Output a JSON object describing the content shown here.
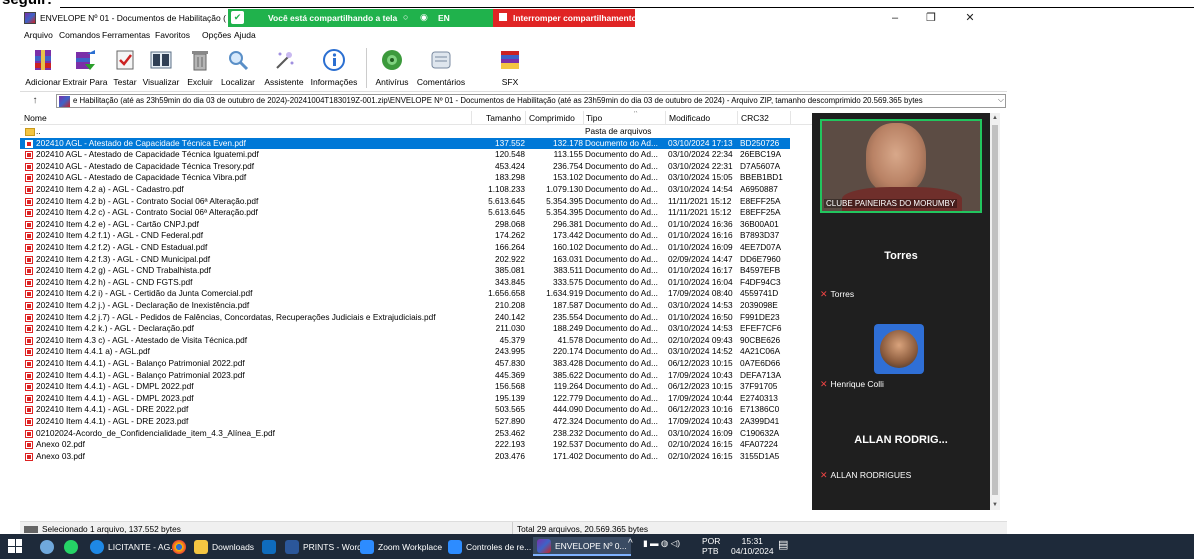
{
  "top_crop_text": "seguir:",
  "window": {
    "title": "ENVELOPE Nº 01 - Documentos de Habilitação (",
    "controls": {
      "minimize": "–",
      "maximize": "❐",
      "close": "✕"
    }
  },
  "share_bar": {
    "message": "Você está compartilhando a tela",
    "lang": "EN",
    "stop_label": "Interromper compartilhamento"
  },
  "menu": [
    "Arquivo",
    "Comandos",
    "Ferramentas",
    "Favoritos",
    "Opções",
    "Ajuda"
  ],
  "toolbar": [
    {
      "label": "Adicionar",
      "icon": "add-archive-icon",
      "color": "#b8322b"
    },
    {
      "label": "Extrair Para",
      "icon": "extract-icon",
      "color": "#6a3fb0"
    },
    {
      "label": "Testar",
      "icon": "test-icon",
      "color": "#c0392b"
    },
    {
      "label": "Visualizar",
      "icon": "view-icon",
      "color": "#6a8aa8"
    },
    {
      "label": "Excluir",
      "icon": "delete-icon",
      "color": "#8c8c8c"
    },
    {
      "label": "Localizar",
      "icon": "find-icon",
      "color": "#5a8fc7"
    },
    {
      "label": "Assistente",
      "icon": "wizard-icon",
      "color": "#8a6fc7"
    },
    {
      "label": "Informações",
      "icon": "info-icon",
      "color": "#2b6fd1"
    },
    {
      "label": "Antivírus",
      "icon": "antivirus-icon",
      "color": "#3c9a3c"
    },
    {
      "label": "Comentários",
      "icon": "comment-icon",
      "color": "#7a8aa0"
    },
    {
      "label": "SFX",
      "icon": "sfx-icon",
      "color": "#c0392b"
    }
  ],
  "address": {
    "up": "↑",
    "path": "e Habilitação (até as 23h59min do dia 03 de outubro de 2024)-20241004T183019Z-001.zip\\ENVELOPE Nº 01 - Documentos de Habilitação (até as 23h59min do dia 03 de outubro de 2024) - Arquivo ZIP, tamanho descomprimido 20.569.365 bytes"
  },
  "columns": {
    "name": "Nome",
    "size": "Tamanho",
    "compressed": "Comprimido",
    "type": "Tipo",
    "modified": "Modificado",
    "crc": "CRC32"
  },
  "files": [
    {
      "name": "..",
      "size": "",
      "compressed": "",
      "type": "Pasta de arquivos",
      "modified": "",
      "crc": "",
      "kind": "folder"
    },
    {
      "name": "202410 AGL - Atestado de Capacidade Técnica Even.pdf",
      "size": "137.552",
      "compressed": "132.178",
      "type": "Documento do Ad...",
      "modified": "03/10/2024 17:13",
      "crc": "BD250726",
      "kind": "pdf",
      "selected": true
    },
    {
      "name": "202410 AGL - Atestado de Capacidade Técnica Iguatemi.pdf",
      "size": "120.548",
      "compressed": "113.155",
      "type": "Documento do Ad...",
      "modified": "03/10/2024 22:34",
      "crc": "26EBC19A",
      "kind": "pdf"
    },
    {
      "name": "202410 AGL - Atestado de Capacidade Técnica Tresory.pdf",
      "size": "453.424",
      "compressed": "236.754",
      "type": "Documento do Ad...",
      "modified": "03/10/2024 22:31",
      "crc": "D7A5607A",
      "kind": "pdf"
    },
    {
      "name": "202410 AGL - Atestado de Capacidade Técnica Vibra.pdf",
      "size": "183.298",
      "compressed": "153.102",
      "type": "Documento do Ad...",
      "modified": "03/10/2024 15:05",
      "crc": "BBEB1BD1",
      "kind": "pdf"
    },
    {
      "name": "202410 Item 4.2 a) - AGL - Cadastro.pdf",
      "size": "1.108.233",
      "compressed": "1.079.130",
      "type": "Documento do Ad...",
      "modified": "03/10/2024 14:54",
      "crc": "A6950887",
      "kind": "pdf"
    },
    {
      "name": "202410 Item 4.2 b) - AGL - Contrato Social 06ª Alteração.pdf",
      "size": "5.613.645",
      "compressed": "5.354.395",
      "type": "Documento do Ad...",
      "modified": "11/11/2021 15:12",
      "crc": "E8EFF25A",
      "kind": "pdf"
    },
    {
      "name": "202410 Item 4.2 c) - AGL - Contrato Social 06ª Alteração.pdf",
      "size": "5.613.645",
      "compressed": "5.354.395",
      "type": "Documento do Ad...",
      "modified": "11/11/2021 15:12",
      "crc": "E8EFF25A",
      "kind": "pdf"
    },
    {
      "name": "202410 Item 4.2 e) - AGL - Cartão CNPJ.pdf",
      "size": "298.068",
      "compressed": "296.381",
      "type": "Documento do Ad...",
      "modified": "01/10/2024 16:36",
      "crc": "36B00A01",
      "kind": "pdf"
    },
    {
      "name": "202410 Item 4.2 f.1) - AGL - CND Federal.pdf",
      "size": "174.262",
      "compressed": "173.442",
      "type": "Documento do Ad...",
      "modified": "01/10/2024 16:16",
      "crc": "B7893D37",
      "kind": "pdf"
    },
    {
      "name": "202410 Item 4.2 f.2) - AGL - CND Estadual.pdf",
      "size": "166.264",
      "compressed": "160.102",
      "type": "Documento do Ad...",
      "modified": "01/10/2024 16:09",
      "crc": "4EE7D07A",
      "kind": "pdf"
    },
    {
      "name": "202410 Item 4.2 f.3) - AGL - CND Municipal.pdf",
      "size": "202.922",
      "compressed": "163.031",
      "type": "Documento do Ad...",
      "modified": "02/09/2024 14:47",
      "crc": "DD6E7960",
      "kind": "pdf"
    },
    {
      "name": "202410 Item 4.2 g) - AGL - CND Trabalhista.pdf",
      "size": "385.081",
      "compressed": "383.511",
      "type": "Documento do Ad...",
      "modified": "01/10/2024 16:17",
      "crc": "B4597EFB",
      "kind": "pdf"
    },
    {
      "name": "202410 Item 4.2 h) - AGL - CND FGTS.pdf",
      "size": "343.845",
      "compressed": "333.575",
      "type": "Documento do Ad...",
      "modified": "01/10/2024 16:04",
      "crc": "F4DF94C3",
      "kind": "pdf"
    },
    {
      "name": "202410 Item 4.2 i) - AGL - Certidão da Junta Comercial.pdf",
      "size": "1.656.658",
      "compressed": "1.634.919",
      "type": "Documento do Ad...",
      "modified": "17/09/2024 08:40",
      "crc": "4559741D",
      "kind": "pdf"
    },
    {
      "name": "202410 Item 4.2 j.) - AGL - Declaração de Inexistência.pdf",
      "size": "210.208",
      "compressed": "187.587",
      "type": "Documento do Ad...",
      "modified": "03/10/2024 14:53",
      "crc": "2039098E",
      "kind": "pdf"
    },
    {
      "name": "202410 Item 4.2 j.7) - AGL - Pedidos de Falências, Concordatas, Recuperações Judiciais e Extrajudiciais.pdf",
      "size": "240.142",
      "compressed": "235.554",
      "type": "Documento do Ad...",
      "modified": "01/10/2024 16:50",
      "crc": "F991DE23",
      "kind": "pdf"
    },
    {
      "name": "202410 Item 4.2 k.) - AGL - Declaração.pdf",
      "size": "211.030",
      "compressed": "188.249",
      "type": "Documento do Ad...",
      "modified": "03/10/2024 14:53",
      "crc": "EFEF7CF6",
      "kind": "pdf"
    },
    {
      "name": "202410 Item 4.3 c) - AGL - Atestado de Visita Técnica.pdf",
      "size": "45.379",
      "compressed": "41.578",
      "type": "Documento do Ad...",
      "modified": "02/10/2024 09:43",
      "crc": "90CBE626",
      "kind": "pdf"
    },
    {
      "name": "202410 Item 4.4.1 a) - AGL.pdf",
      "size": "243.995",
      "compressed": "220.174",
      "type": "Documento do Ad...",
      "modified": "03/10/2024 14:52",
      "crc": "4A21C06A",
      "kind": "pdf"
    },
    {
      "name": "202410 Item 4.4.1) - AGL - Balanço Patrimonial 2022.pdf",
      "size": "457.830",
      "compressed": "383.428",
      "type": "Documento do Ad...",
      "modified": "06/12/2023 10:15",
      "crc": "0A7E6D66",
      "kind": "pdf"
    },
    {
      "name": "202410 Item 4.4.1) - AGL - Balanço Patrimonial 2023.pdf",
      "size": "445.369",
      "compressed": "385.622",
      "type": "Documento do Ad...",
      "modified": "17/09/2024 10:43",
      "crc": "DEFA713A",
      "kind": "pdf"
    },
    {
      "name": "202410 Item 4.4.1) - AGL - DMPL 2022.pdf",
      "size": "156.568",
      "compressed": "119.264",
      "type": "Documento do Ad...",
      "modified": "06/12/2023 10:15",
      "crc": "37F91705",
      "kind": "pdf"
    },
    {
      "name": "202410 Item 4.4.1) - AGL - DMPL 2023.pdf",
      "size": "195.139",
      "compressed": "122.779",
      "type": "Documento do Ad...",
      "modified": "17/09/2024 10:44",
      "crc": "E2740313",
      "kind": "pdf"
    },
    {
      "name": "202410 Item 4.4.1) - AGL - DRE 2022.pdf",
      "size": "503.565",
      "compressed": "444.090",
      "type": "Documento do Ad...",
      "modified": "06/12/2023 10:16",
      "crc": "E71386C0",
      "kind": "pdf"
    },
    {
      "name": "202410 Item 4.4.1) - AGL - DRE 2023.pdf",
      "size": "527.890",
      "compressed": "472.324",
      "type": "Documento do Ad...",
      "modified": "17/09/2024 10:43",
      "crc": "2A399D41",
      "kind": "pdf"
    },
    {
      "name": "02102024-Acordo_de_Confidencialidade_item_4.3_Alínea_E.pdf",
      "size": "253.462",
      "compressed": "238.232",
      "type": "Documento do Ad...",
      "modified": "03/10/2024 16:09",
      "crc": "C190632A",
      "kind": "pdf"
    },
    {
      "name": "Anexo 02.pdf",
      "size": "222.193",
      "compressed": "192.537",
      "type": "Documento do Ad...",
      "modified": "02/10/2024 16:15",
      "crc": "4FA07224",
      "kind": "pdf"
    },
    {
      "name": "Anexo 03.pdf",
      "size": "203.476",
      "compressed": "171.402",
      "type": "Documento do Ad...",
      "modified": "02/10/2024 16:15",
      "crc": "3155D1A5",
      "kind": "pdf"
    }
  ],
  "status": {
    "left": "Selecionado 1 arquivo, 137.552 bytes",
    "right": "Total 29 arquivos, 20.569.365 bytes"
  },
  "zoom": {
    "video_caption": "CLUBE PAINEIRAS DO MORUMBY",
    "participant1_big": "Torres",
    "participant1_small": "Torres",
    "participant2_small": "Henrique Colli",
    "participant3_big": "ALLAN RODRIG...",
    "participant3_small": "ALLAN RODRIGUES"
  },
  "taskbar": {
    "apps": [
      {
        "label": "LICITANTE - AG...",
        "color": "#1e88e5"
      },
      {
        "label": "",
        "color": "#e53935"
      },
      {
        "label": "Downloads",
        "color": "#f4c542"
      },
      {
        "label": "",
        "color": "#2b579a"
      },
      {
        "label": "PRINTS - Word",
        "color": "#2b579a"
      },
      {
        "label": "Zoom Workplace",
        "color": "#2d8cff"
      },
      {
        "label": "Controles de re...",
        "color": "#2d8cff"
      },
      {
        "label": "ENVELOPE Nº 0...",
        "color": "#7b2fa8"
      }
    ],
    "lang": "POR",
    "lang2": "PTB",
    "time": "15:31",
    "date": "04/10/2024"
  }
}
